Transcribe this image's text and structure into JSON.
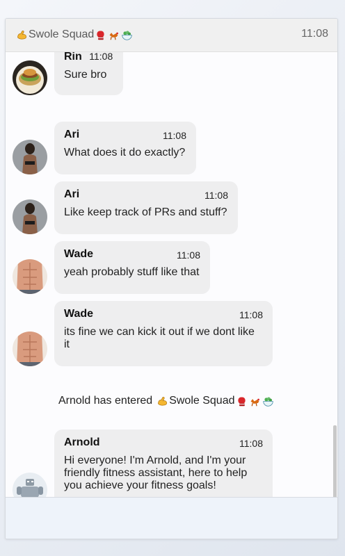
{
  "chat": {
    "title": "Swole Squad",
    "time": "11:08"
  },
  "messages": [
    {
      "sender": "Rin",
      "time": "11:08",
      "text": "Sure bro"
    },
    {
      "sender": "Ari",
      "time": "11:08",
      "text": "What does it do exactly?"
    },
    {
      "sender": "Ari",
      "time": "11:08",
      "text": "Like keep track of PRs and stuff?"
    },
    {
      "sender": "Wade",
      "time": "11:08",
      "text": "yeah probably stuff like that"
    },
    {
      "sender": "Wade",
      "time": "11:08",
      "text": "its fine we can kick it out if we dont like it"
    },
    {
      "sender": "Arnold",
      "time": "11:08",
      "text": "Hi everyone! I'm Arnold, and I'm your friendly fitness assistant, here to help you achieve your fitness goals!"
    }
  ],
  "system_message": {
    "prefix": "Arnold has entered",
    "chat_name": "Swole Squad"
  },
  "icons": {
    "title_prefix": "flexed-biceps-icon",
    "title_suffix": [
      "boxing-glove-icon",
      "rooster-icon",
      "salad-icon"
    ]
  },
  "colors": {
    "bubble": "#eeeeef",
    "header": "#f0f0f0",
    "composer": "#eef3fa"
  }
}
